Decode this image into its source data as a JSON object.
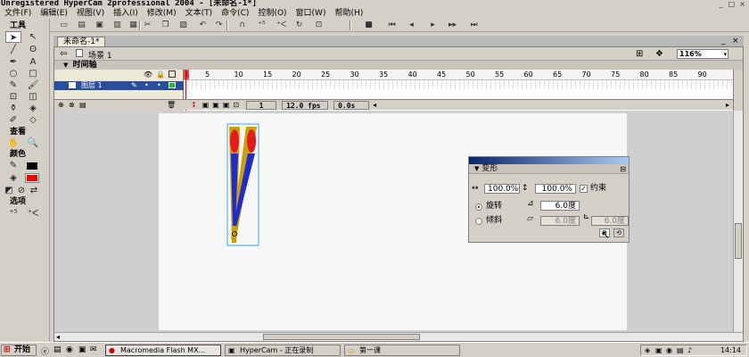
{
  "window": {
    "title": "Unregistered HyperCam 2professional 2004 - [未命名-1*]"
  },
  "menu": [
    "文件(F)",
    "编辑(E)",
    "视图(V)",
    "插入(I)",
    "修改(M)",
    "文本(T)",
    "命令(C)",
    "控制(O)",
    "窗口(W)",
    "帮助(H)"
  ],
  "tools": {
    "header": "工具",
    "view_header": "查看",
    "color_header": "颜色",
    "options_header": "选项",
    "stroke_color": "#000000",
    "fill_color": "#ff0000"
  },
  "document": {
    "tab": "未命名-1*",
    "scene": "场景 1",
    "zoom": "116%"
  },
  "timeline": {
    "header": "时间轴",
    "layer_name": "图层 1",
    "ruler_ticks": [
      "1",
      "5",
      "10",
      "15",
      "20",
      "25",
      "30",
      "35",
      "40",
      "45",
      "50",
      "55",
      "60",
      "65",
      "70",
      "75",
      "80",
      "85",
      "90"
    ],
    "current_frame": "1",
    "fps": "12.0 fps",
    "time": "0.0s"
  },
  "transform_panel": {
    "title": "变形",
    "width_pct": "100.0%",
    "height_pct": "100.0%",
    "constrain_label": "约束",
    "constrain_checked": true,
    "rotate_label": "旋转",
    "rotate_value": "6.0度",
    "skew_label": "倾斜",
    "skew_h": "6.0度",
    "skew_v": "6.0度"
  },
  "taskbar": {
    "start": "开始",
    "tasks": [
      "Macromedia Flash MX...",
      "HyperCam - 正在录制",
      "第一课"
    ],
    "clock": "14:14"
  }
}
